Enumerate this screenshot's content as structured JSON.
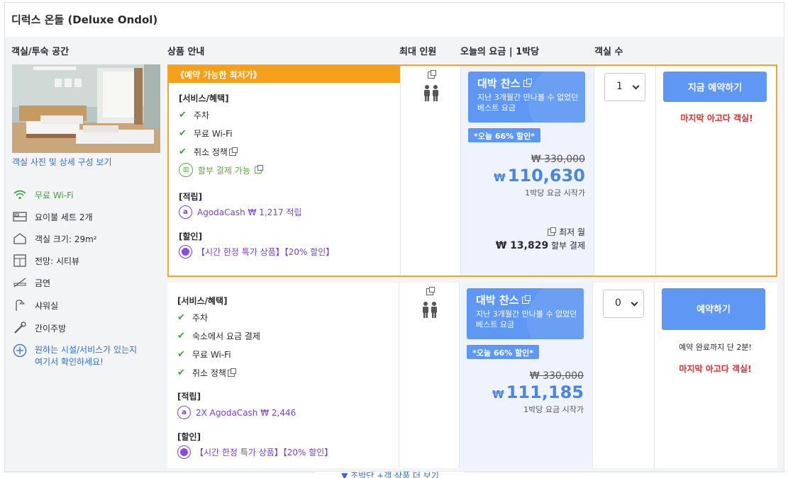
{
  "room": {
    "title": "디럭스 온돌 (Deluxe Ondol)"
  },
  "headers": {
    "room_space": "객실/투숙 공간",
    "product_info": "상품 안내",
    "max_occupancy": "최대 인원",
    "todays_rate": "오늘의 요금 | 1박당",
    "room_count": "객실 수"
  },
  "left": {
    "photo_link": "객실 사진 및 상세 구성 보기",
    "amenities": [
      {
        "label": "무료 Wi-Fi",
        "icon": "wifi-icon"
      },
      {
        "label": "요이불 세트 2개",
        "icon": "bed-icon"
      },
      {
        "label": "객실 크기: 29m²",
        "icon": "house-icon"
      },
      {
        "label": "전망: 시티뷰",
        "icon": "window-icon"
      },
      {
        "label": "금연",
        "icon": "no-smoking-icon"
      },
      {
        "label": "샤워실",
        "icon": "shower-icon"
      },
      {
        "label": "간이주방",
        "icon": "kitchen-icon"
      }
    ],
    "facility_line1": "원하는 시설/서비스가 있는지",
    "facility_line2": "여기서 확인하세요!"
  },
  "offer1": {
    "banner": "《예약 가능한 최저가》",
    "benefits_title": "[서비스/혜택]",
    "benefits": [
      "주차",
      "무료 Wi-Fi",
      "취소 정책"
    ],
    "installment": "할부 결제 가능",
    "earn_title": "[적립]",
    "earn_text": "AgodaCash ₩ 1,217 적립",
    "discount_title": "[할인]",
    "discount_text": "【시간 한정 특가 상품】【20% 할인】",
    "deal_title": "대박 찬스",
    "deal_desc": "지난 3개월간 만나볼 수 없었던 베스트 요금",
    "discount_badge": "*오늘 66% 할인*",
    "original_price": "₩ 330,000",
    "currency": "₩",
    "price": "110,630",
    "per_night": "1박당 요금 시작가",
    "monthly_label": "최저 월",
    "monthly_amount": "₩ 13,829",
    "monthly_suffix": "할부 결제",
    "qty": "1",
    "book_label": "지금 예약하기",
    "last_room": "마지막 아고다 객실!"
  },
  "offer2": {
    "benefits_title": "[서비스/혜택]",
    "benefits": [
      "주차",
      "숙소에서 요금 결제",
      "무료 Wi-Fi",
      "취소 정책"
    ],
    "earn_title": "[적립]",
    "earn_text": "2X AgodaCash ₩ 2,446",
    "discount_title": "[할인]",
    "discount_text": "【시간 한정 특가 상품】【20% 할인】",
    "deal_title": "대박 찬스",
    "deal_desc": "지난 3개월간 만나볼 수 없었던 베스트 요금",
    "discount_badge": "*오늘 66% 할인*",
    "original_price": "₩ 330,000",
    "currency": "₩",
    "price": "111,185",
    "per_night": "1박당 요금 시작가",
    "qty": "0",
    "book_label": "예약하기",
    "minutes_left": "예약 완료까지 단 2분!",
    "last_room": "마지막 아고다 객실!"
  },
  "more": {
    "label": "▼ 조박단 +객 상품 더 보기"
  },
  "colors": {
    "accent_blue": "#5f97f4",
    "best_orange": "#f5a01a",
    "check_green": "#3ea33e",
    "agoda_purple": "#7b3fd6",
    "alert_red": "#e12d2d"
  }
}
